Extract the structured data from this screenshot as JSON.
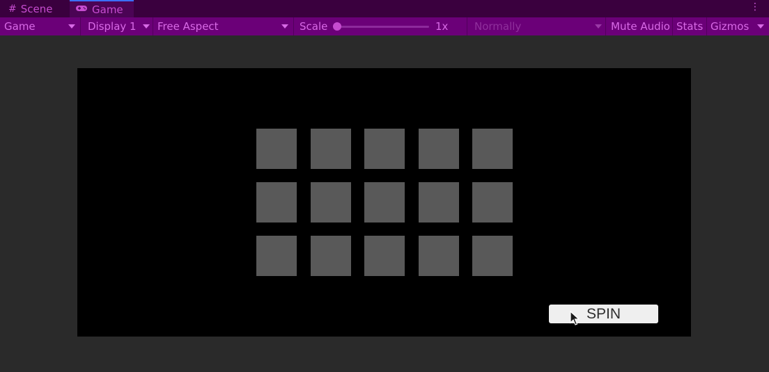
{
  "tabs": [
    {
      "label": "Scene",
      "icon": "grid-icon"
    },
    {
      "label": "Game",
      "icon": "gamepad-icon",
      "active": true
    }
  ],
  "toolbar": {
    "view_select": "Game",
    "display_select": "Display 1",
    "aspect_select": "Free Aspect",
    "scale_label": "Scale",
    "scale_value": "1x",
    "play_mode_select": "Normally",
    "mute_audio": "Mute Audio",
    "stats": "Stats",
    "gizmos": "Gizmos"
  },
  "game": {
    "grid_rows": 3,
    "grid_cols": 5,
    "spin_label": "SPIN"
  },
  "colors": {
    "tabbar_bg": "#3a003e",
    "toolbar_bg": "#6b0078",
    "accent_text": "#d86ae6",
    "slot_color": "#595959",
    "viewport_bg": "#000000",
    "editor_bg": "#2a2a2a"
  }
}
